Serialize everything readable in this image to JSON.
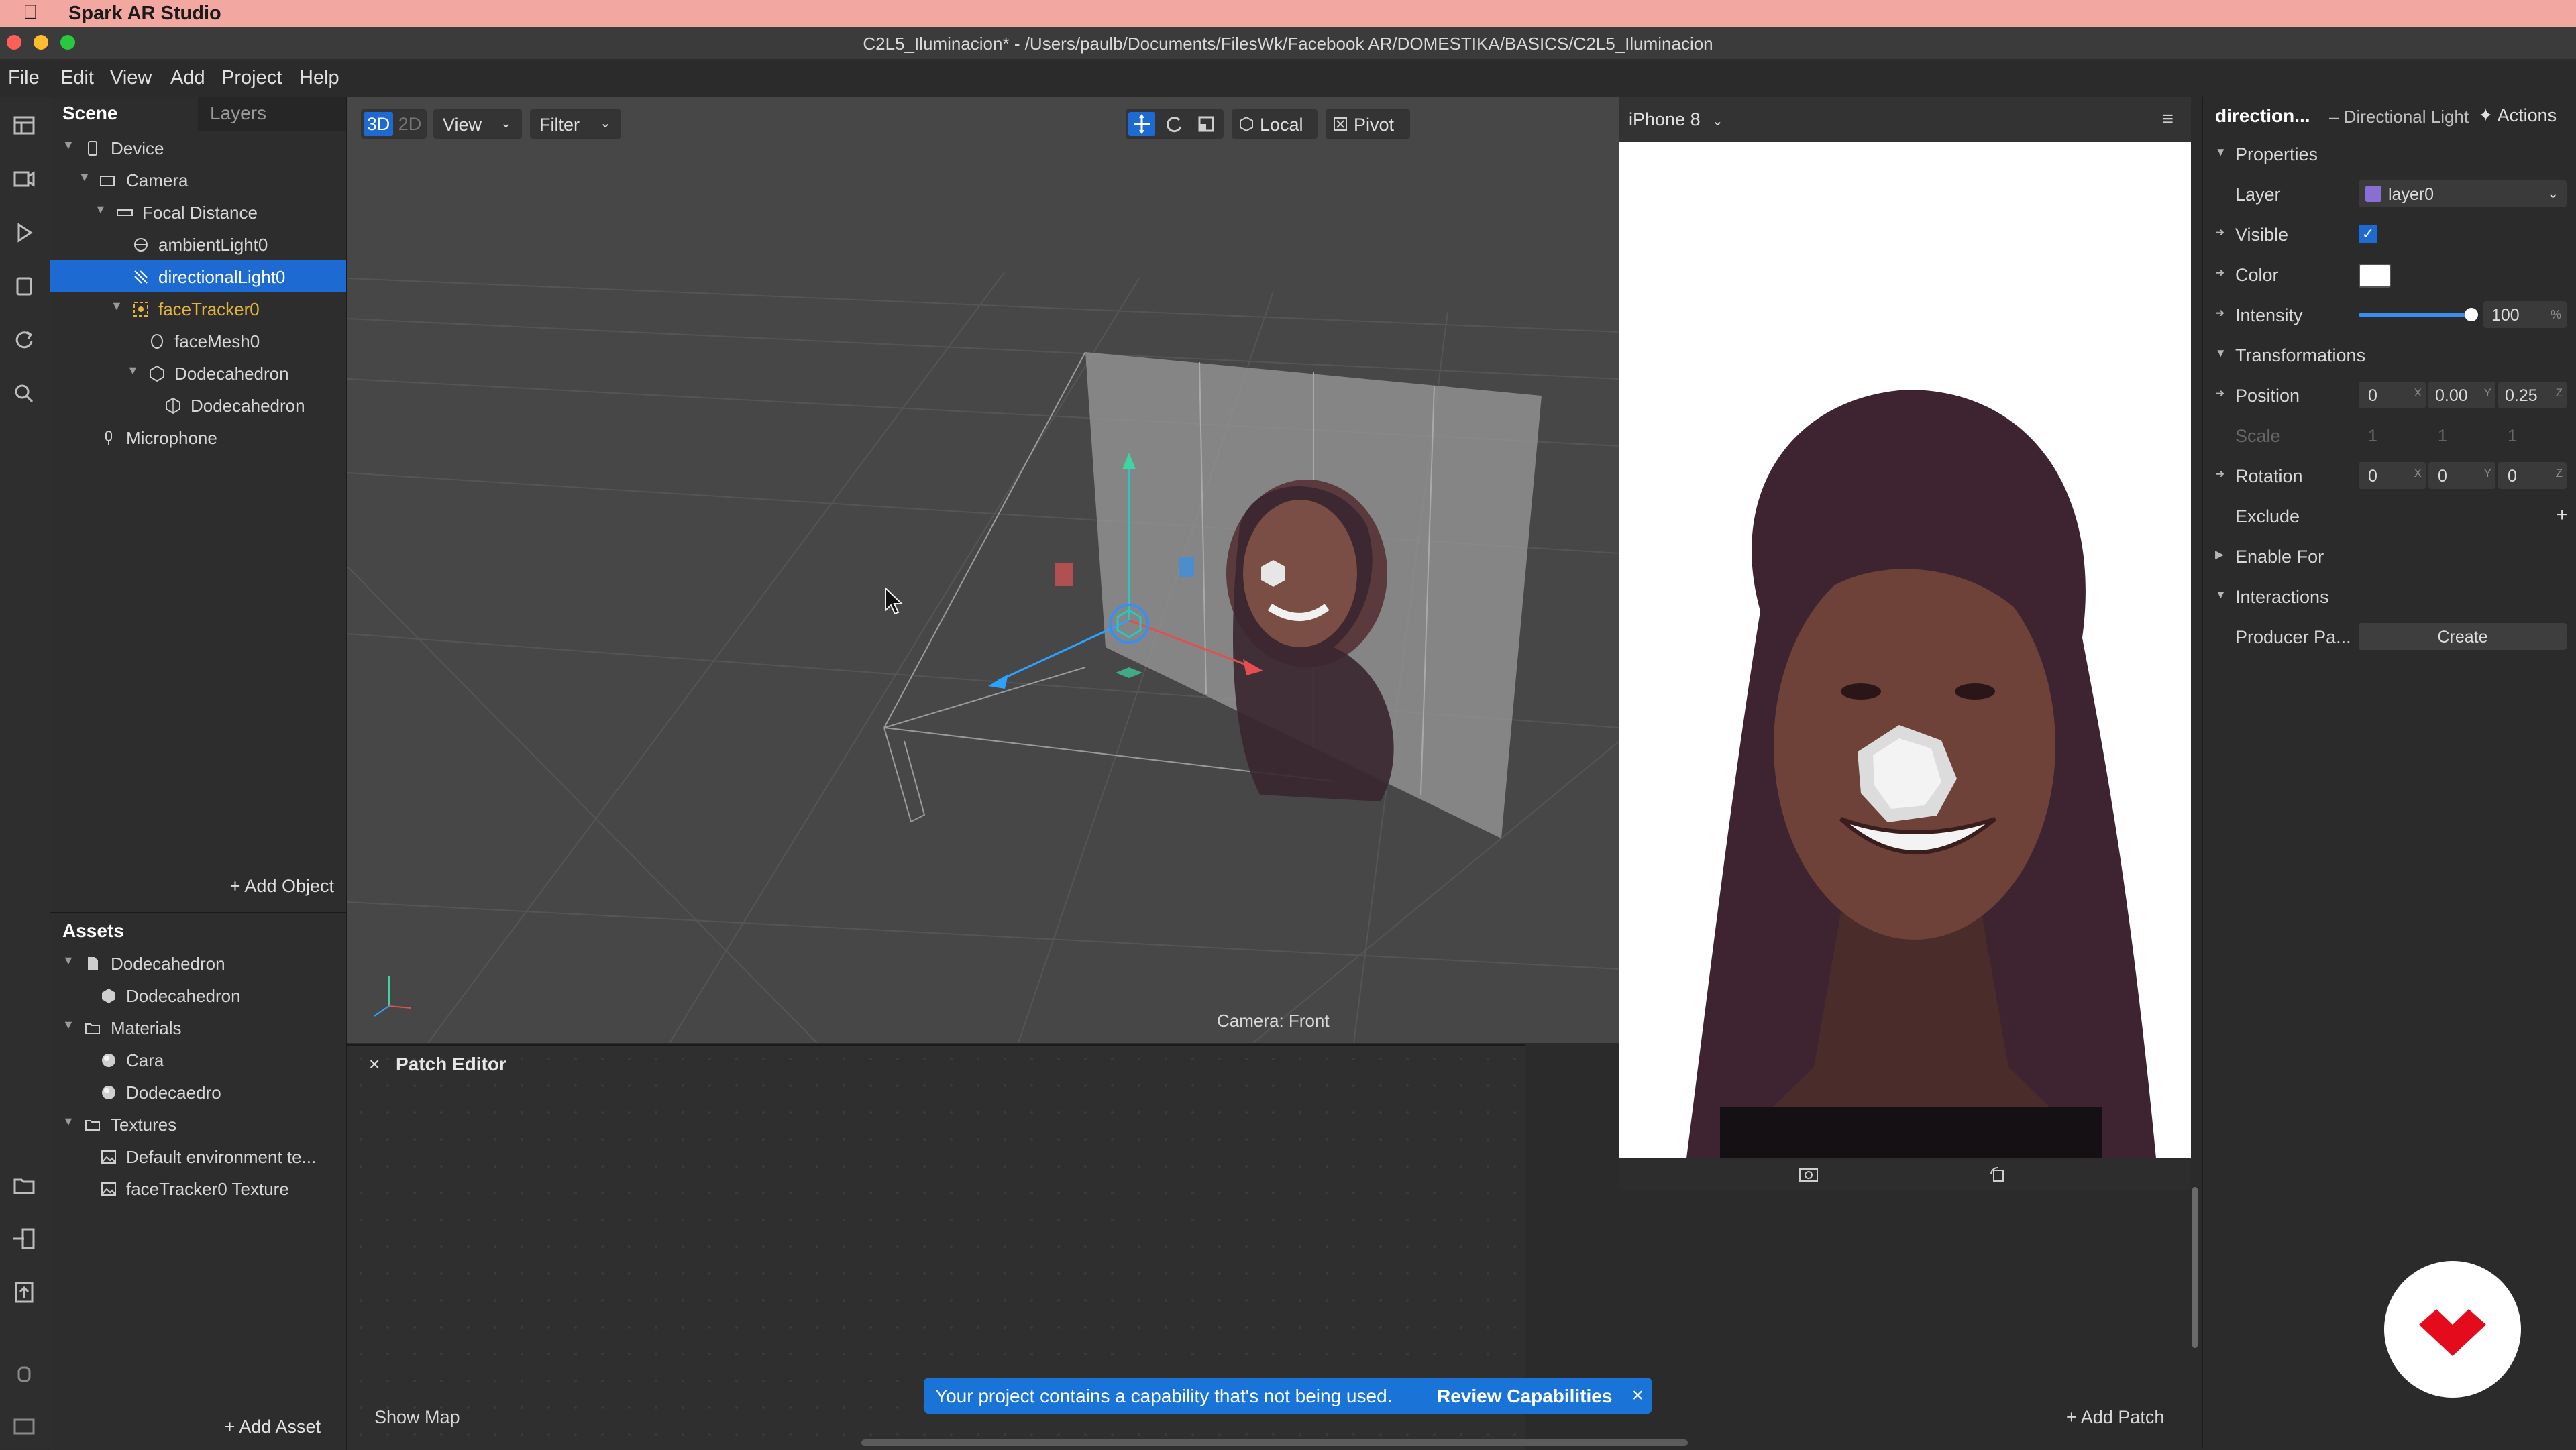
{
  "macbar": {
    "app_name": "Spark AR Studio"
  },
  "window": {
    "title": "C2L5_Iluminacion* - /Users/paulb/Documents/FilesWk/Facebook AR/DOMESTIKA/BASICS/C2L5_Iluminacion"
  },
  "menu": [
    "File",
    "Edit",
    "View",
    "Add",
    "Project",
    "Help"
  ],
  "scene": {
    "tabs": [
      "Scene",
      "Layers"
    ],
    "items": [
      {
        "label": "Device",
        "icon": "device-icon"
      },
      {
        "label": "Camera",
        "icon": "camera-icon"
      },
      {
        "label": "Focal Distance",
        "icon": "focal-distance-icon"
      },
      {
        "label": "ambientLight0",
        "icon": "ambient-light-icon"
      },
      {
        "label": "directionalLight0",
        "icon": "directional-light-icon"
      },
      {
        "label": "faceTracker0",
        "icon": "face-tracker-icon"
      },
      {
        "label": "faceMesh0",
        "icon": "face-mesh-icon"
      },
      {
        "label": "Dodecahedron",
        "icon": "object-icon"
      },
      {
        "label": "Dodecahedron",
        "icon": "mesh-icon"
      },
      {
        "label": "Microphone",
        "icon": "microphone-icon"
      }
    ],
    "add_object": "Add Object"
  },
  "assets": {
    "title": "Assets",
    "items": [
      {
        "label": "Dodecahedron",
        "icon": "file-icon"
      },
      {
        "label": "Dodecahedron",
        "icon": "mesh-icon"
      },
      {
        "label": "Materials",
        "icon": "folder-icon"
      },
      {
        "label": "Cara",
        "icon": "material-sphere-icon"
      },
      {
        "label": "Dodecaedro",
        "icon": "material-sphere-icon"
      },
      {
        "label": "Textures",
        "icon": "folder-icon"
      },
      {
        "label": "Default environment te...",
        "icon": "texture-icon"
      },
      {
        "label": "faceTracker0 Texture",
        "icon": "texture-icon"
      }
    ],
    "add_asset": "Add Asset"
  },
  "viewport": {
    "mode_3d": "3D",
    "mode_2d": "2D",
    "view": "View",
    "filter": "Filter",
    "local": "Local",
    "pivot": "Pivot",
    "camera_label": "Camera: Front"
  },
  "preview": {
    "device": "iPhone 8"
  },
  "inspector": {
    "object_name": "direction...",
    "object_type": "– Directional Light",
    "actions": "Actions",
    "sections": {
      "properties": "Properties",
      "transformations": "Transformations",
      "interactions": "Interactions"
    },
    "layer_label": "Layer",
    "layer_value": "layer0",
    "visible_label": "Visible",
    "color_label": "Color",
    "intensity_label": "Intensity",
    "intensity_value": "100",
    "intensity_unit": "%",
    "intensity_level": 1.0,
    "position_label": "Position",
    "position": [
      "0",
      "0.00",
      "0.25"
    ],
    "scale_label": "Scale",
    "scale": [
      "1",
      "1",
      "1"
    ],
    "rotation_label": "Rotation",
    "rotation": [
      "0",
      "0",
      "0"
    ],
    "axes": [
      "X",
      "Y",
      "Z"
    ],
    "exclude_label": "Exclude",
    "enable_for_label": "Enable For",
    "producer_label": "Producer Pa...",
    "create_label": "Create"
  },
  "patch_editor": {
    "title": "Patch Editor",
    "show_map": "Show Map",
    "add_patch": "Add Patch"
  },
  "notification": {
    "message": "Your project contains a capability that's not being used.",
    "action": "Review Capabilities"
  },
  "colors": {
    "selection": "#1d6ad2",
    "notification": "#1a74d8",
    "tracker": "#e4b43c",
    "badge": "#e30b1c"
  }
}
